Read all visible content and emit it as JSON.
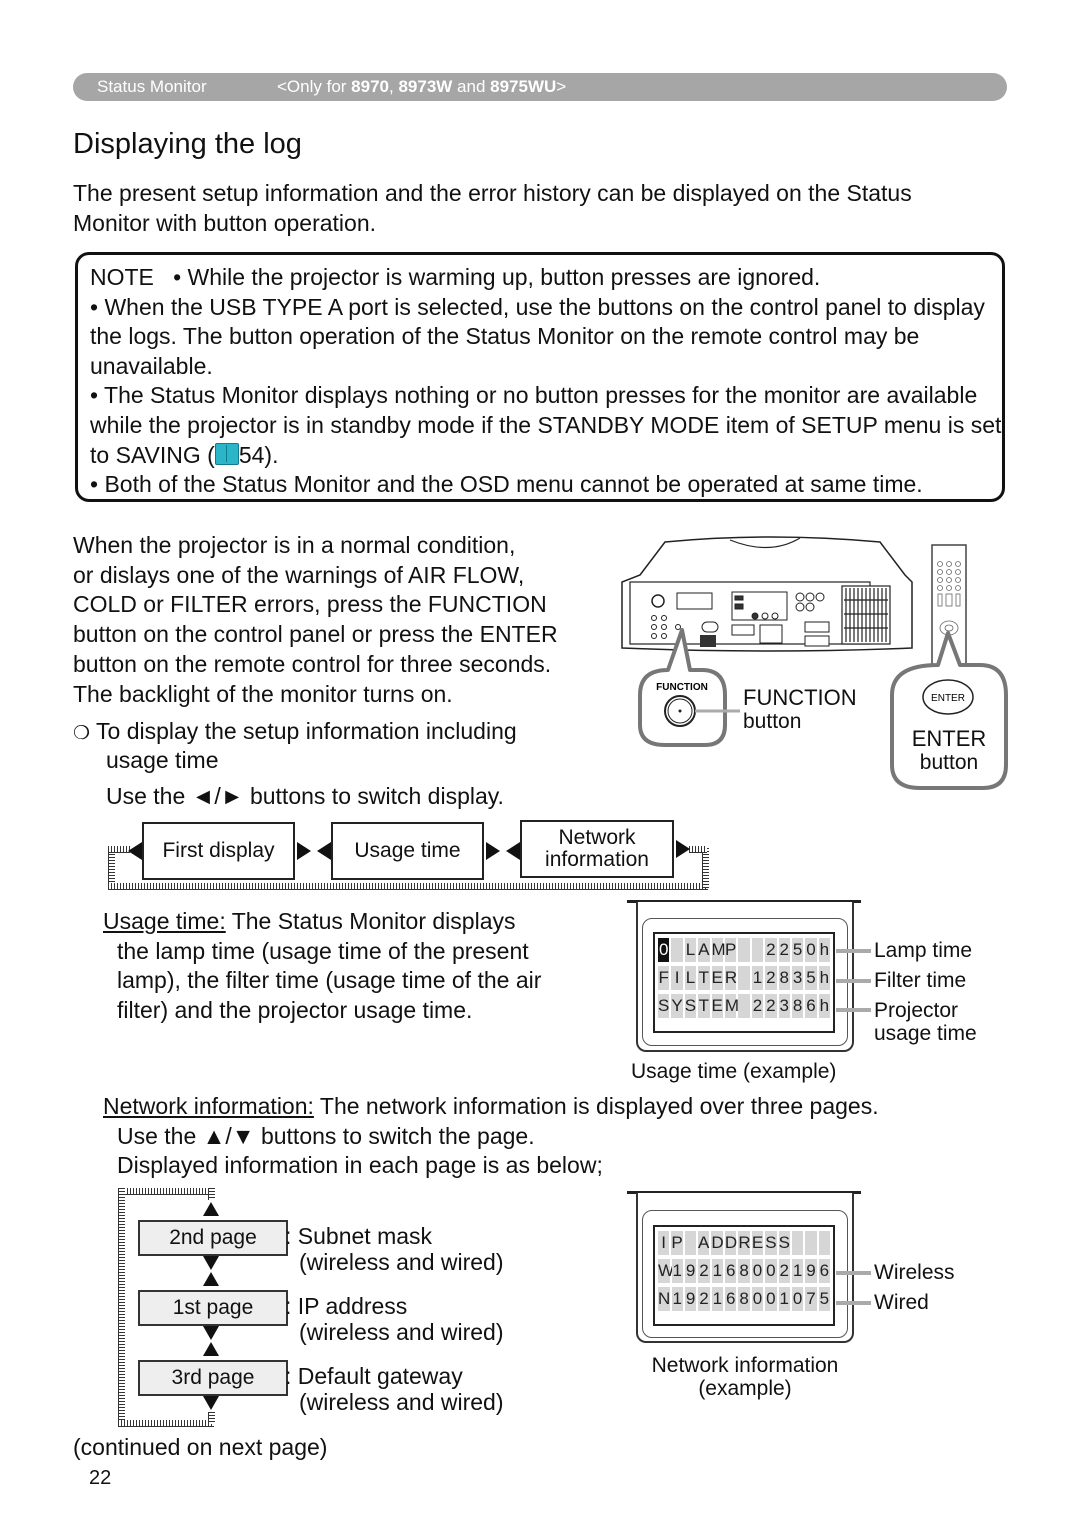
{
  "header": {
    "section": "Status Monitor",
    "only_prefix": "<Only for ",
    "model1": "8970",
    "sep1": ", ",
    "model2": "8973W",
    "sep2": " and ",
    "model3": "8975WU",
    "only_suffix": ">"
  },
  "title": "Displaying the log",
  "intro": "The present setup information and the error history can be displayed on the Status Monitor with button operation.",
  "note": {
    "label": "NOTE",
    "items": [
      "• While the projector is warming up, button presses are ignored.",
      "• When the USB TYPE A port is selected, use the buttons on the control panel to display the logs. The button operation of the Status Monitor on the remote control may be unavailable.",
      "• The Status Monitor displays nothing or no button presses for the monitor are available while the projector is in standby mode if the STANDBY MODE item of SETUP menu is set to SAVING (",
      "54).",
      "• Both of the Status Monitor and the OSD menu cannot be operated at same time."
    ]
  },
  "instructions": {
    "lines": [
      "When the projector is in a normal condition,",
      "or dislays one of the warnings of AIR FLOW,",
      "COLD or FILTER errors, press the FUNCTION",
      "button on the control panel or press the ENTER",
      "button on the remote control for three seconds.",
      "The backlight of the monitor turns on."
    ],
    "bullet_symbol": "❍",
    "bullet_line1": "To display the setup information including",
    "bullet_line2": "usage time",
    "switch_display": "Use the ◄/► buttons to switch display."
  },
  "illustration": {
    "function_panel_label": "FUNCTION",
    "function_label": "FUNCTION",
    "function_sub": "button",
    "enter_key": "ENTER",
    "enter_label": "ENTER",
    "enter_sub": "button"
  },
  "display_flow": [
    {
      "label": "First display"
    },
    {
      "label": "Usage time"
    },
    {
      "label": "Network information"
    }
  ],
  "usage_time": {
    "term": "Usage time:",
    "lines": [
      " The Status Monitor displays",
      "the lamp time (usage time of the present",
      "lamp), the filter time (usage time of the air",
      "filter) and the projector usage time."
    ],
    "lcd_rows": [
      {
        "chars": [
          "0",
          " ",
          "L",
          "A",
          "M",
          "P",
          " ",
          " ",
          "2",
          "2",
          "5",
          "0",
          "h"
        ],
        "highlight": 0,
        "label": "Lamp time"
      },
      {
        "chars": [
          "F",
          "I",
          "L",
          "T",
          "E",
          "R",
          " ",
          "1",
          "2",
          "8",
          "3",
          "5",
          "h"
        ],
        "highlight": -1,
        "label": "Filter time"
      },
      {
        "chars": [
          "S",
          "Y",
          "S",
          "T",
          "E",
          "M",
          " ",
          "2",
          "2",
          "3",
          "8",
          "6",
          "h"
        ],
        "highlight": -1,
        "label": "Projector usage time"
      }
    ],
    "projector_label_1": "Projector",
    "projector_label_2": "usage time",
    "caption": "Usage time (example)"
  },
  "network": {
    "term": "Network information:",
    "line1": " The network information is displayed over three pages.",
    "line2": "Use the ▲/▼ buttons to switch the page.",
    "line3": "Displayed information in each page is as below;",
    "pages": [
      {
        "label": "2nd page",
        "desc1": ": Subnet mask",
        "desc2": "(wireless and wired)"
      },
      {
        "label": "1st page",
        "desc1": ": IP address",
        "desc2": "(wireless and wired)"
      },
      {
        "label": "3rd page",
        "desc1": ": Default gateway",
        "desc2": "(wireless and wired)"
      }
    ],
    "lcd_rows": [
      {
        "chars": [
          "I",
          "P",
          " ",
          "A",
          "D",
          "D",
          "R",
          "E",
          "S",
          "S",
          " ",
          " ",
          " "
        ],
        "label": ""
      },
      {
        "chars": [
          "W",
          "1",
          "9",
          "2",
          "1",
          "6",
          "8",
          "0",
          "0",
          "2",
          "1",
          "9",
          "6"
        ],
        "label": "Wireless"
      },
      {
        "chars": [
          "N",
          "1",
          "9",
          "2",
          "1",
          "6",
          "8",
          "0",
          "0",
          "1",
          "0",
          "7",
          "5"
        ],
        "label": "Wired"
      }
    ],
    "caption1": "Network information",
    "caption2": "(example)"
  },
  "footer": {
    "continued": "(continued on next page)",
    "page_number": "22"
  }
}
